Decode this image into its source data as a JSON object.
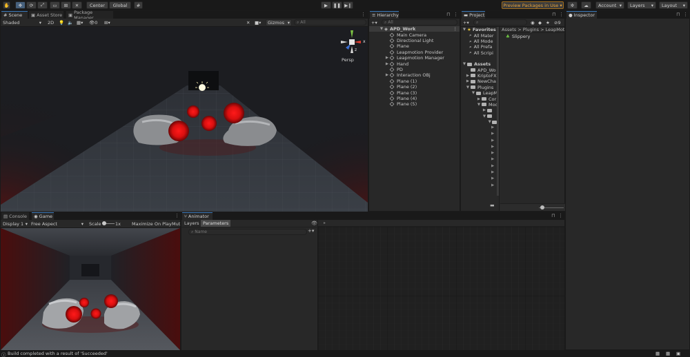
{
  "toolbar": {
    "center_label": "Center",
    "global_label": "Global",
    "preview_label": "Preview Packages in Use",
    "account_label": "Account",
    "layers_label": "Layers",
    "layout_label": "Layout"
  },
  "scene_panel": {
    "tabs": [
      "Scene",
      "Asset Store",
      "Package Manager"
    ],
    "shading": "Shaded",
    "mode_2d": "2D",
    "hidden_count": "0",
    "gizmos": "Gizmos",
    "search_placeholder": "All",
    "persp": "Persp",
    "axis_x": "x",
    "axis_z": "z"
  },
  "hierarchy": {
    "tab": "Hierarchy",
    "search_placeholder": "All",
    "root": "APD_Work",
    "items": [
      "Main Camera",
      "Directional Light",
      "Plane",
      "Leapmotion Provider",
      "Leapmotion Manager",
      "Hand",
      "PD",
      "Interaction OBj",
      "Plane (1)",
      "Plane (2)",
      "Plane (3)",
      "Plane (4)",
      "Plane (5)"
    ]
  },
  "project": {
    "tab": "Project",
    "favorites_label": "Favorites",
    "favorites": [
      "All Mater",
      "All Mode",
      "All Prefa",
      "All Scripi"
    ],
    "assets_label": "Assets",
    "assets": [
      "APD_Wo",
      "KriptoFX",
      "NewCha",
      "Plugins"
    ],
    "plugin_children": [
      "LeapM",
      "Cor",
      "Mod"
    ],
    "breadcrumb": "Assets > Plugins > LeapMotio",
    "content_item": "Slippery",
    "hidden_count": "9"
  },
  "inspector": {
    "tab": "Inspector"
  },
  "game_panel": {
    "tabs": [
      "Console",
      "Game"
    ],
    "display": "Display 1",
    "aspect": "Free Aspect",
    "scale_label": "Scale",
    "scale_value": "1x",
    "maximize": "Maximize On Play",
    "mute": "Mut"
  },
  "animator": {
    "tab": "Animator",
    "layers_tab": "Layers",
    "parameters_tab": "Parameters",
    "name_placeholder": "Name"
  },
  "status": {
    "message": "Build completed with a result of 'Succeeded'"
  }
}
